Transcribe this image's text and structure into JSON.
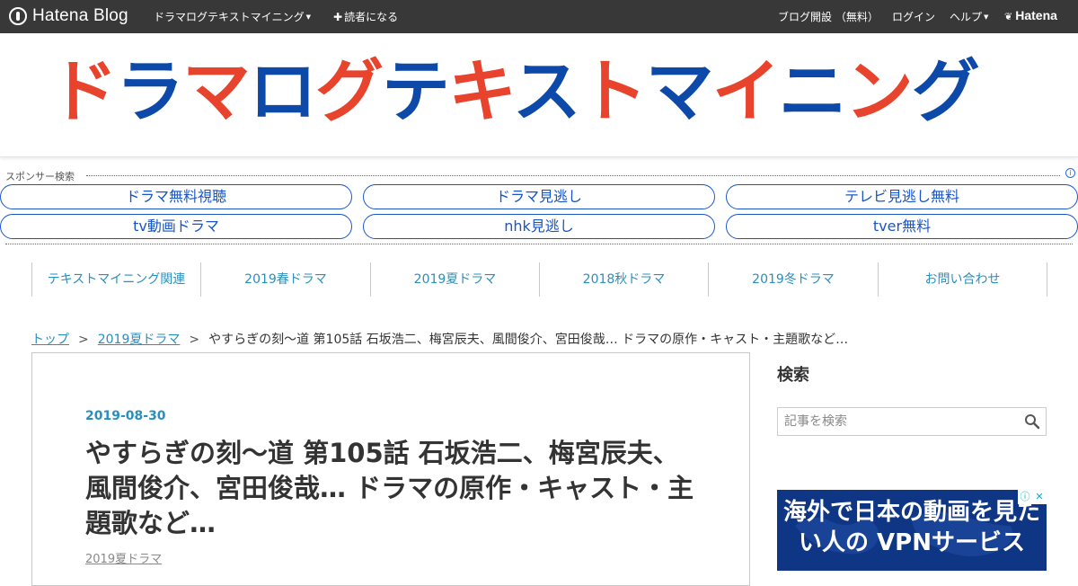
{
  "topbar": {
    "brand": "Hatena Blog",
    "blog_menu": "ドラマログテキストマイニング",
    "subscribe": "読者になる",
    "signup": "ブログ開設 （無料）",
    "login": "ログイン",
    "help": "ヘルプ",
    "hatena": "Hatena"
  },
  "header": {
    "banner_parts": [
      {
        "text": "ド",
        "color": "red"
      },
      {
        "text": "ラ",
        "color": "blue"
      },
      {
        "text": "マ",
        "color": "red"
      },
      {
        "text": "ロ",
        "color": "blue"
      },
      {
        "text": "グ",
        "color": "red"
      },
      {
        "text": "テ",
        "color": "blue"
      },
      {
        "text": "キ",
        "color": "red"
      },
      {
        "text": "ス",
        "color": "blue"
      },
      {
        "text": "ト",
        "color": "red"
      },
      {
        "text": "マ",
        "color": "blue"
      },
      {
        "text": "イ",
        "color": "red"
      },
      {
        "text": "ニ",
        "color": "blue"
      },
      {
        "text": "ン",
        "color": "red"
      },
      {
        "text": "グ",
        "color": "blue"
      }
    ],
    "colors": {
      "red": "#e8432d",
      "blue": "#0d49a8"
    }
  },
  "sponsor": {
    "label": "スポンサー検索",
    "info": "i",
    "links": [
      "ドラマ無料視聴",
      "ドラマ見逃し",
      "テレビ見逃し無料",
      "tv動画ドラマ",
      "nhk見逃し",
      "tver無料"
    ]
  },
  "nav": {
    "items": [
      "テキストマイニング関連",
      "2019春ドラマ",
      "2019夏ドラマ",
      "2018秋ドラマ",
      "2019冬ドラマ",
      "お問い合わせ"
    ]
  },
  "breadcrumb": {
    "home": "トップ",
    "sep": ">",
    "category": "2019夏ドラマ",
    "current": "やすらぎの刻～道 第105話 石坂浩二、梅宮辰夫、風間俊介、宮田俊哉… ドラマの原作・キャスト・主題歌など…"
  },
  "article": {
    "date": "2019-08-30",
    "title": "やすらぎの刻～道 第105話 石坂浩二、梅宮辰夫、風間俊介、宮田俊哉… ドラマの原作・キャスト・主題歌など…",
    "category": "2019夏ドラマ"
  },
  "sidebar": {
    "search_title": "検索",
    "search_placeholder": "記事を検索"
  },
  "ad": {
    "text": "海外で日本の動画を見たい人の VPNサービス"
  },
  "colors": {
    "topbar_bg": "#383838",
    "link": "#2a8fbd",
    "sponsor_link": "#1a55c6",
    "ad_bg": "#0f3585"
  }
}
